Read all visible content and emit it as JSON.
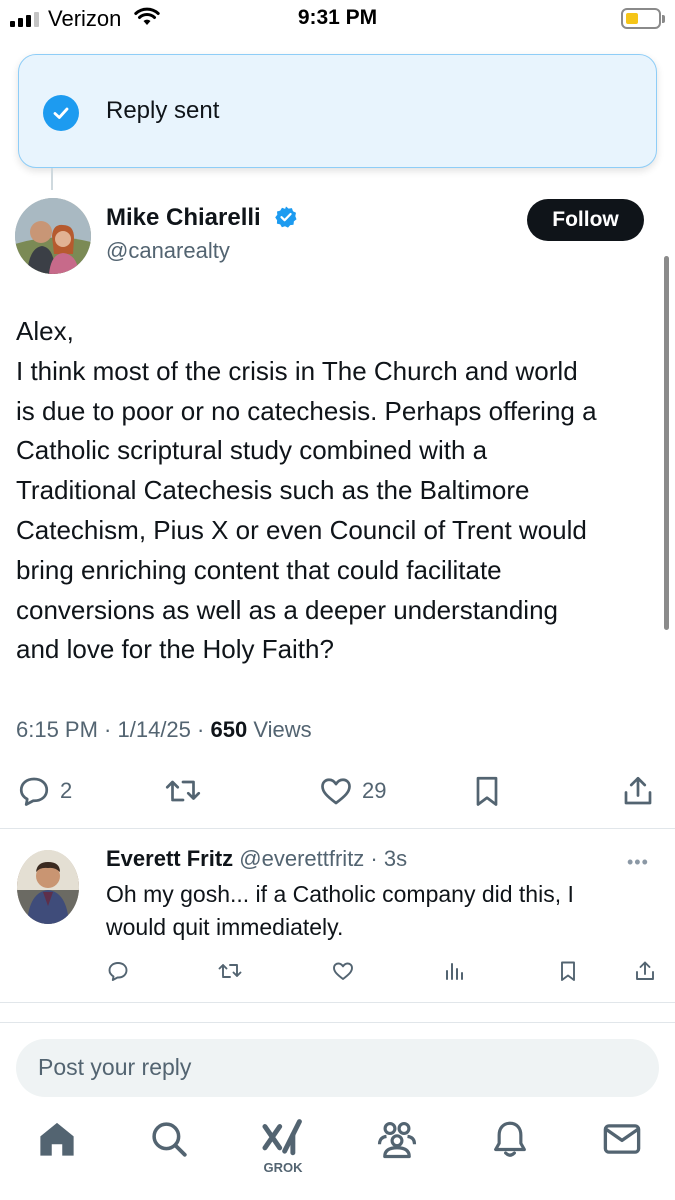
{
  "status_bar": {
    "carrier": "Verizon",
    "time": "9:31 PM",
    "battery_level": 0.4,
    "battery_color": "#f5c518"
  },
  "toast": {
    "text": "Reply sent",
    "icon": "check-circle-icon",
    "accent": "#1d9bf0"
  },
  "post": {
    "author_name": "Mike Chiarelli",
    "author_handle": "@canarealty",
    "verified": true,
    "follow_label": "Follow",
    "body_lines": [
      "Alex,",
      "I think most of the crisis in The Church and world",
      "is due to poor or no catechesis. Perhaps offering a",
      "Catholic scriptural study combined with a",
      "Traditional Catechesis such as the Baltimore",
      "Catechism, Pius X or even Council of Trent would",
      "bring enriching content that could facilitate",
      "conversions as well as a deeper understanding",
      "and love for the Holy Faith?"
    ],
    "meta": {
      "time": "6:15 PM",
      "date": "1/14/25",
      "views_count": "650",
      "views_label": "Views"
    },
    "actions": {
      "reply_count": "2",
      "like_count": "29"
    }
  },
  "reply": {
    "author_name": "Everett Fritz",
    "author_handle": "@everettfritz",
    "time": "3s",
    "text_lines": [
      "Oh my gosh... if a Catholic company did this, I",
      "would quit immediately."
    ]
  },
  "composer": {
    "placeholder": "Post your reply"
  },
  "nav": {
    "items": [
      "home-icon",
      "search-icon",
      "grok-icon",
      "communities-icon",
      "notifications-icon",
      "messages-icon"
    ],
    "grok_label": "GROK"
  },
  "colors": {
    "text": "#0f1419",
    "secondary": "#536471",
    "accent": "#1d9bf0",
    "toast_bg": "#e8f4fd",
    "toast_border": "#8ecdf7"
  }
}
